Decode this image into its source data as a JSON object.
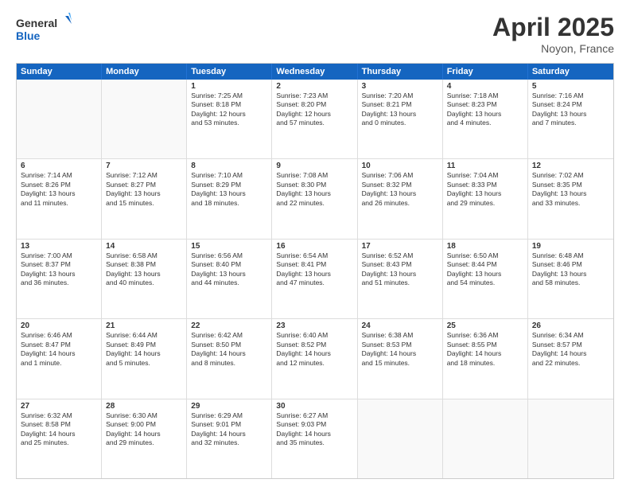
{
  "header": {
    "logo_line1": "General",
    "logo_line2": "Blue",
    "title": "April 2025",
    "subtitle": "Noyon, France"
  },
  "days_of_week": [
    "Sunday",
    "Monday",
    "Tuesday",
    "Wednesday",
    "Thursday",
    "Friday",
    "Saturday"
  ],
  "weeks": [
    [
      {
        "day": "",
        "info": ""
      },
      {
        "day": "",
        "info": ""
      },
      {
        "day": "1",
        "info": "Sunrise: 7:25 AM\nSunset: 8:18 PM\nDaylight: 12 hours\nand 53 minutes."
      },
      {
        "day": "2",
        "info": "Sunrise: 7:23 AM\nSunset: 8:20 PM\nDaylight: 12 hours\nand 57 minutes."
      },
      {
        "day": "3",
        "info": "Sunrise: 7:20 AM\nSunset: 8:21 PM\nDaylight: 13 hours\nand 0 minutes."
      },
      {
        "day": "4",
        "info": "Sunrise: 7:18 AM\nSunset: 8:23 PM\nDaylight: 13 hours\nand 4 minutes."
      },
      {
        "day": "5",
        "info": "Sunrise: 7:16 AM\nSunset: 8:24 PM\nDaylight: 13 hours\nand 7 minutes."
      }
    ],
    [
      {
        "day": "6",
        "info": "Sunrise: 7:14 AM\nSunset: 8:26 PM\nDaylight: 13 hours\nand 11 minutes."
      },
      {
        "day": "7",
        "info": "Sunrise: 7:12 AM\nSunset: 8:27 PM\nDaylight: 13 hours\nand 15 minutes."
      },
      {
        "day": "8",
        "info": "Sunrise: 7:10 AM\nSunset: 8:29 PM\nDaylight: 13 hours\nand 18 minutes."
      },
      {
        "day": "9",
        "info": "Sunrise: 7:08 AM\nSunset: 8:30 PM\nDaylight: 13 hours\nand 22 minutes."
      },
      {
        "day": "10",
        "info": "Sunrise: 7:06 AM\nSunset: 8:32 PM\nDaylight: 13 hours\nand 26 minutes."
      },
      {
        "day": "11",
        "info": "Sunrise: 7:04 AM\nSunset: 8:33 PM\nDaylight: 13 hours\nand 29 minutes."
      },
      {
        "day": "12",
        "info": "Sunrise: 7:02 AM\nSunset: 8:35 PM\nDaylight: 13 hours\nand 33 minutes."
      }
    ],
    [
      {
        "day": "13",
        "info": "Sunrise: 7:00 AM\nSunset: 8:37 PM\nDaylight: 13 hours\nand 36 minutes."
      },
      {
        "day": "14",
        "info": "Sunrise: 6:58 AM\nSunset: 8:38 PM\nDaylight: 13 hours\nand 40 minutes."
      },
      {
        "day": "15",
        "info": "Sunrise: 6:56 AM\nSunset: 8:40 PM\nDaylight: 13 hours\nand 44 minutes."
      },
      {
        "day": "16",
        "info": "Sunrise: 6:54 AM\nSunset: 8:41 PM\nDaylight: 13 hours\nand 47 minutes."
      },
      {
        "day": "17",
        "info": "Sunrise: 6:52 AM\nSunset: 8:43 PM\nDaylight: 13 hours\nand 51 minutes."
      },
      {
        "day": "18",
        "info": "Sunrise: 6:50 AM\nSunset: 8:44 PM\nDaylight: 13 hours\nand 54 minutes."
      },
      {
        "day": "19",
        "info": "Sunrise: 6:48 AM\nSunset: 8:46 PM\nDaylight: 13 hours\nand 58 minutes."
      }
    ],
    [
      {
        "day": "20",
        "info": "Sunrise: 6:46 AM\nSunset: 8:47 PM\nDaylight: 14 hours\nand 1 minute."
      },
      {
        "day": "21",
        "info": "Sunrise: 6:44 AM\nSunset: 8:49 PM\nDaylight: 14 hours\nand 5 minutes."
      },
      {
        "day": "22",
        "info": "Sunrise: 6:42 AM\nSunset: 8:50 PM\nDaylight: 14 hours\nand 8 minutes."
      },
      {
        "day": "23",
        "info": "Sunrise: 6:40 AM\nSunset: 8:52 PM\nDaylight: 14 hours\nand 12 minutes."
      },
      {
        "day": "24",
        "info": "Sunrise: 6:38 AM\nSunset: 8:53 PM\nDaylight: 14 hours\nand 15 minutes."
      },
      {
        "day": "25",
        "info": "Sunrise: 6:36 AM\nSunset: 8:55 PM\nDaylight: 14 hours\nand 18 minutes."
      },
      {
        "day": "26",
        "info": "Sunrise: 6:34 AM\nSunset: 8:57 PM\nDaylight: 14 hours\nand 22 minutes."
      }
    ],
    [
      {
        "day": "27",
        "info": "Sunrise: 6:32 AM\nSunset: 8:58 PM\nDaylight: 14 hours\nand 25 minutes."
      },
      {
        "day": "28",
        "info": "Sunrise: 6:30 AM\nSunset: 9:00 PM\nDaylight: 14 hours\nand 29 minutes."
      },
      {
        "day": "29",
        "info": "Sunrise: 6:29 AM\nSunset: 9:01 PM\nDaylight: 14 hours\nand 32 minutes."
      },
      {
        "day": "30",
        "info": "Sunrise: 6:27 AM\nSunset: 9:03 PM\nDaylight: 14 hours\nand 35 minutes."
      },
      {
        "day": "",
        "info": ""
      },
      {
        "day": "",
        "info": ""
      },
      {
        "day": "",
        "info": ""
      }
    ]
  ]
}
